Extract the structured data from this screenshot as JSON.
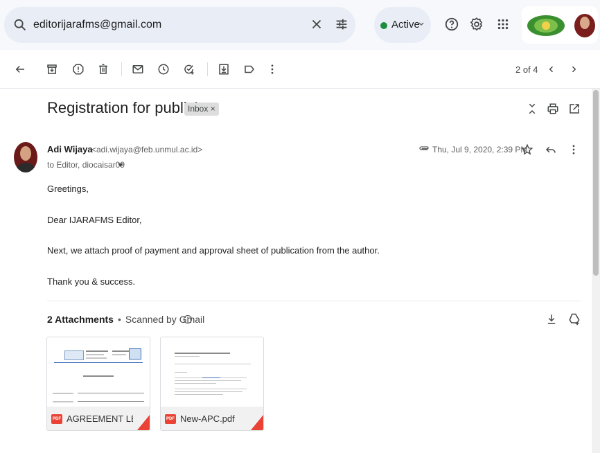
{
  "search": {
    "query": "editorijarafms@gmail.com"
  },
  "status": {
    "label": "Active"
  },
  "toolbar": {
    "pager": "2 of 4"
  },
  "email": {
    "subject": "Registration for publish",
    "label": "Inbox ×",
    "sender_name": "Adi Wijaya",
    "sender_email": "<adi.wijaya@feb.unmul.ac.id>",
    "recipients": "to Editor, diocaisar09",
    "datetime": "Thu, Jul 9, 2020, 2:39 PM",
    "body": [
      "Greetings,",
      "Dear IJARAFMS Editor,",
      "Next, we attach proof of payment and approval sheet of publication from the author.",
      "Thank you & success."
    ]
  },
  "attachments": {
    "count_label": "2 Attachments",
    "separator": "•",
    "scanned_label": "Scanned by Gmail",
    "files": [
      {
        "name": "AGREEMENT LET...",
        "type": "PDF"
      },
      {
        "name": "New-APC.pdf",
        "type": "PDF"
      }
    ]
  },
  "colors": {
    "accent": "#0b57d0",
    "active_dot": "#1e8e3e",
    "pdf_red": "#ea4335"
  }
}
